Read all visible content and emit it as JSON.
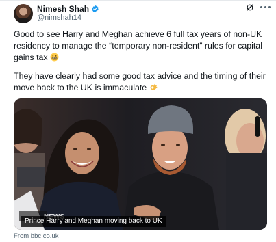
{
  "author": {
    "display_name": "Nimesh Shah",
    "handle": "@nimshah14"
  },
  "tweet": {
    "paragraph1": "Good to see Harry and Meghan achieve 6 full tax years of non-UK residency to manage the “temporary non-resident” rules for capital gains tax",
    "paragraph2": "They have clearly had some good tax advice and the timing of their move back to the UK is immaculate"
  },
  "media": {
    "caption": "Prince Harry and Meghan moving back to UK",
    "watermark": "NEWS"
  },
  "card": {
    "source": "From bbc.co.uk"
  },
  "icons": {
    "verified": "verified-badge-icon",
    "grok": "grok-icon",
    "more": "more-icon",
    "emoji1": "grimacing-face-emoji",
    "emoji2": "ok-hand-emoji"
  },
  "colors": {
    "verified": "#1d9bf0",
    "text": "#0f1419",
    "secondary_text": "#536471"
  }
}
